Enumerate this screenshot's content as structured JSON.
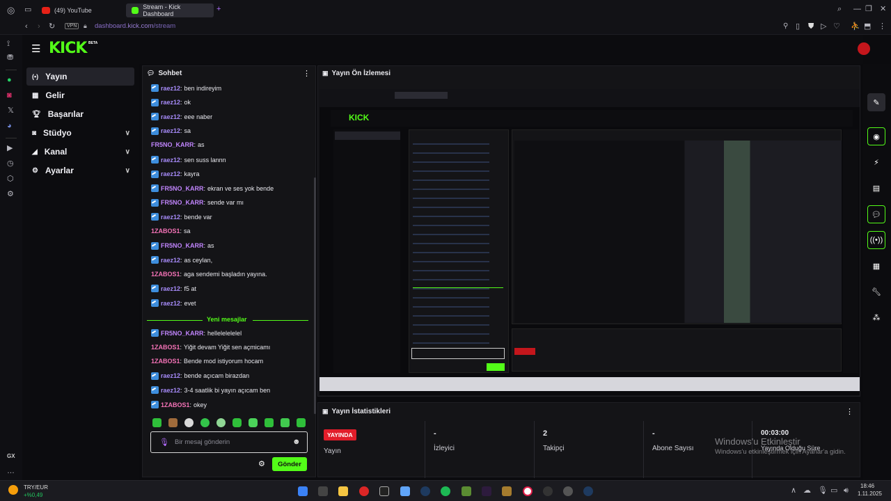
{
  "browser": {
    "tabs": [
      {
        "label": "(49) YouTube"
      },
      {
        "label": "Stream - Kick Dashboard"
      }
    ],
    "vpn_label": "VPN",
    "url_domain": "dashboard.",
    "url_host": "kick.com",
    "url_path": "/stream"
  },
  "brand": {
    "logo": "KICK",
    "beta": "BETA",
    "accent": "#53fc18"
  },
  "nav": {
    "items": [
      {
        "label": "Yayın",
        "icon": "broadcast-icon"
      },
      {
        "label": "Gelir",
        "icon": "revenue-icon"
      },
      {
        "label": "Başarılar",
        "icon": "trophy-icon"
      },
      {
        "label": "Stüdyo",
        "icon": "studio-icon"
      },
      {
        "label": "Kanal",
        "icon": "channel-icon"
      },
      {
        "label": "Ayarlar",
        "icon": "settings-icon"
      }
    ]
  },
  "chat": {
    "title": "Sohbet",
    "messages": [
      {
        "user": "raez12",
        "text": "ben indireyim",
        "color": "#a78bfa",
        "badge": true
      },
      {
        "user": "raez12",
        "text": "ok",
        "color": "#a78bfa",
        "badge": true
      },
      {
        "user": "raez12",
        "text": "eee naber",
        "color": "#a78bfa",
        "badge": true
      },
      {
        "user": "raez12",
        "text": "sa",
        "color": "#a78bfa",
        "badge": true
      },
      {
        "user": "FR5NO_KARR",
        "text": "as",
        "color": "#c084fc",
        "badge": false
      },
      {
        "user": "raez12",
        "text": "sen suss lannn",
        "color": "#a78bfa",
        "badge": true
      },
      {
        "user": "raez12",
        "text": "kayra",
        "color": "#a78bfa",
        "badge": true
      },
      {
        "user": "FR5NO_KARR",
        "text": "ekran ve ses yok bende",
        "color": "#c084fc",
        "badge": true
      },
      {
        "user": "FR5NO_KARR",
        "text": "sende var mı",
        "color": "#c084fc",
        "badge": true
      },
      {
        "user": "raez12",
        "text": "bende var",
        "color": "#a78bfa",
        "badge": true
      },
      {
        "user": "1ZABOS1",
        "text": "sa",
        "color": "#f472b6",
        "badge": false
      },
      {
        "user": "FR5NO_KARR",
        "text": "as",
        "color": "#c084fc",
        "badge": true
      },
      {
        "user": "raez12",
        "text": "as ceylan,",
        "color": "#a78bfa",
        "badge": true
      },
      {
        "user": "1ZABOS1",
        "text": "aga sendemi başladın yayına.",
        "color": "#f472b6",
        "badge": false
      },
      {
        "user": "raez12",
        "text": "f5 at",
        "color": "#a78bfa",
        "badge": true
      },
      {
        "user": "raez12",
        "text": "evet",
        "color": "#a78bfa",
        "badge": true
      }
    ],
    "divider_label": "Yeni mesajlar",
    "new_messages": [
      {
        "user": "FR5NO_KARR",
        "text": "hellelelelelel",
        "color": "#c084fc",
        "badge": true
      },
      {
        "user": "1ZABOS1",
        "text": "Yiğit devam Yiğit sen açmicamı",
        "color": "#f472b6",
        "badge": false
      },
      {
        "user": "1ZABOS1",
        "text": "Bende mod istiyorum hocam",
        "color": "#f472b6",
        "badge": false
      },
      {
        "user": "raez12",
        "text": "bende açıcam birazdan",
        "color": "#a78bfa",
        "badge": true
      },
      {
        "user": "raez12",
        "text": "3-4 saatlik bi yayın açıcam ben",
        "color": "#a78bfa",
        "badge": true
      },
      {
        "user": "1ZABOS1",
        "text": "okey",
        "color": "#f472b6",
        "badge": true
      }
    ],
    "input_placeholder": "Bir mesaj gönderin",
    "send_label": "Gönder"
  },
  "preview": {
    "title": "Yayın Ön İzlemesi"
  },
  "stats": {
    "title": "Yayın İstatistikleri",
    "live_badge": "YAYINDA",
    "cells": [
      {
        "value": "",
        "label": "Yayın"
      },
      {
        "value": "-",
        "label": "İzleyici"
      },
      {
        "value": "2",
        "label": "Takipçi"
      },
      {
        "value": "-",
        "label": "Abone Sayısı"
      },
      {
        "value": "00:03:00",
        "label": "Yayında Olduğu Süre"
      }
    ],
    "watermark_title": "Windows'u Etkinleştir",
    "watermark_sub": "Windows'u etkinleştirmek için Ayarlar'a gidin."
  },
  "taskbar": {
    "ticker": "TRY/EUR",
    "ticker_change": "+%0,49",
    "time": "18:46",
    "date": "1.11.2025"
  },
  "opera_gx_label": "GX"
}
